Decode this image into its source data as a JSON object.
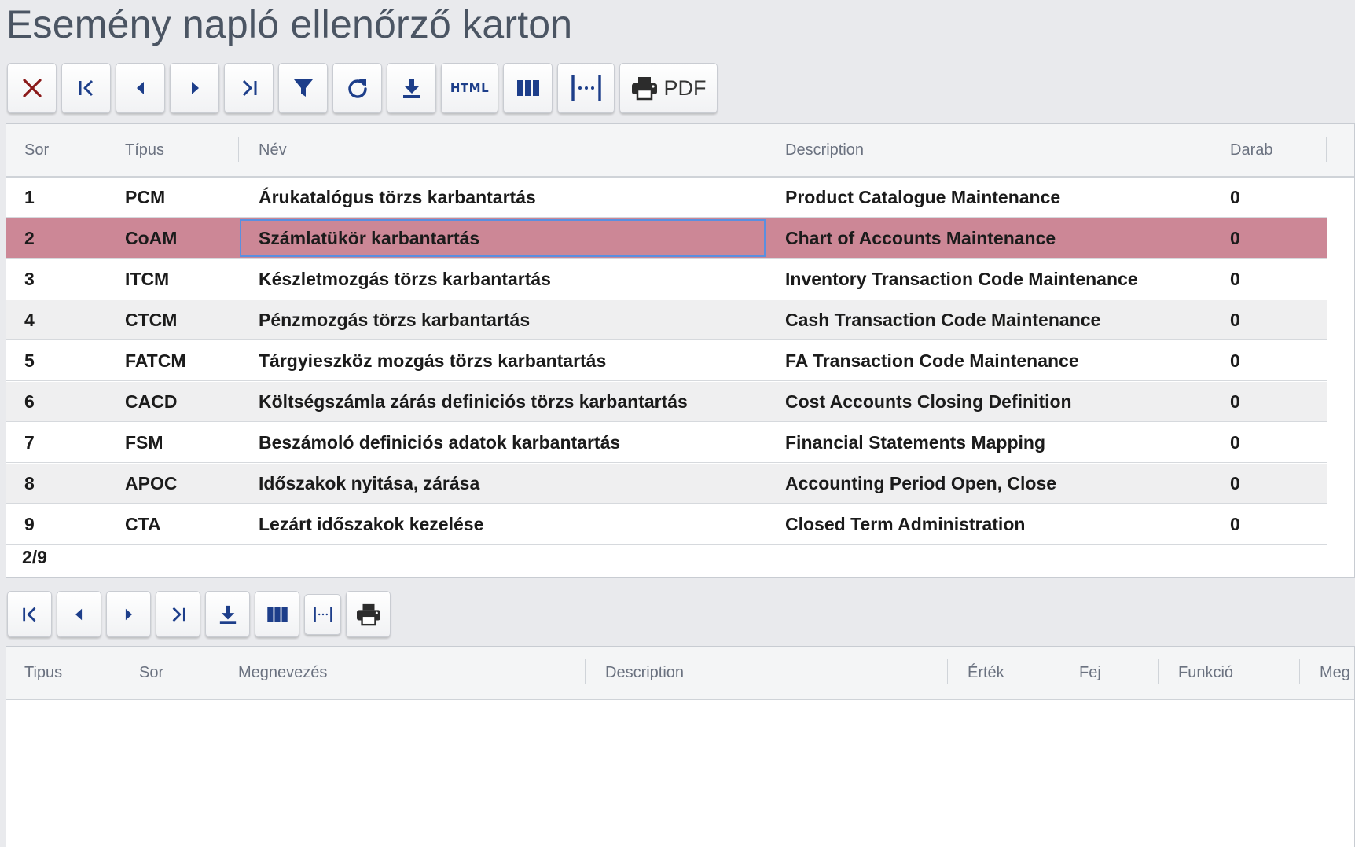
{
  "page": {
    "title": "Esemény napló ellenőrző karton"
  },
  "toolbar_top": {
    "buttons": [
      {
        "icon": "close-icon"
      },
      {
        "icon": "first-page-icon"
      },
      {
        "icon": "prev-page-icon"
      },
      {
        "icon": "next-page-icon"
      },
      {
        "icon": "last-page-icon"
      },
      {
        "icon": "filter-icon"
      },
      {
        "icon": "refresh-icon"
      },
      {
        "icon": "download-icon"
      },
      {
        "icon": "html-export-icon",
        "label": "HTML"
      },
      {
        "icon": "columns-icon"
      },
      {
        "icon": "fit-columns-icon"
      },
      {
        "icon": "print-icon",
        "label": "PDF"
      }
    ]
  },
  "main_grid": {
    "columns": [
      "Sor",
      "Típus",
      "Név",
      "Description",
      "Darab"
    ],
    "rows": [
      {
        "sor": "1",
        "tipus": "PCM",
        "nev": "Árukatalógus törzs karbantartás",
        "description": "Product Catalogue Maintenance",
        "darab": "0"
      },
      {
        "sor": "2",
        "tipus": "CoAM",
        "nev": "Számlatükör karbantartás",
        "description": "Chart of Accounts Maintenance",
        "darab": "0"
      },
      {
        "sor": "3",
        "tipus": "ITCM",
        "nev": "Készletmozgás törzs karbantartás",
        "description": "Inventory Transaction Code Maintenance",
        "darab": "0"
      },
      {
        "sor": "4",
        "tipus": "CTCM",
        "nev": "Pénzmozgás törzs karbantartás",
        "description": "Cash Transaction Code Maintenance",
        "darab": "0"
      },
      {
        "sor": "5",
        "tipus": "FATCM",
        "nev": "Tárgyieszköz mozgás törzs karbantartás",
        "description": "FA Transaction Code Maintenance",
        "darab": "0"
      },
      {
        "sor": "6",
        "tipus": "CACD",
        "nev": "Költségszámla zárás definiciós törzs karbantartás",
        "description": "Cost Accounts Closing Definition",
        "darab": "0"
      },
      {
        "sor": "7",
        "tipus": "FSM",
        "nev": "Beszámoló definiciós adatok karbantartás",
        "description": "Financial Statements Mapping",
        "darab": "0"
      },
      {
        "sor": "8",
        "tipus": "APOC",
        "nev": "Időszakok nyitása, zárása",
        "description": "Accounting Period Open, Close",
        "darab": "0"
      },
      {
        "sor": "9",
        "tipus": "CTA",
        "nev": "Lezárt időszakok kezelése",
        "description": "Closed Term Administration",
        "darab": "0"
      }
    ],
    "selected_row": 2,
    "counter": "2/9"
  },
  "toolbar_bottom": {
    "buttons": [
      {
        "icon": "first-page-icon"
      },
      {
        "icon": "prev-page-icon"
      },
      {
        "icon": "next-page-icon"
      },
      {
        "icon": "last-page-icon"
      },
      {
        "icon": "download-icon"
      },
      {
        "icon": "columns-icon"
      },
      {
        "icon": "fit-columns-icon"
      },
      {
        "icon": "print-icon"
      }
    ]
  },
  "detail_grid": {
    "columns": [
      "Tipus",
      "Sor",
      "Megnevezés",
      "Description",
      "Érték",
      "Fej",
      "Funkció",
      "Meg"
    ]
  },
  "colors": {
    "background": "#e9eaed",
    "selected_row": "#cc8796",
    "icon_blue": "#1d3e8a",
    "close_red": "#8b1a1a",
    "focus_border": "#5a8fe0"
  }
}
